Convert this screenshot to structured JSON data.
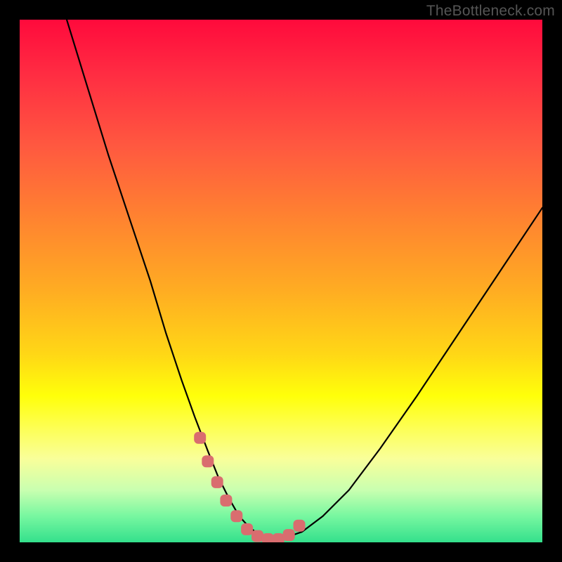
{
  "watermark": "TheBottleneck.com",
  "colors": {
    "page_bg": "#000000",
    "gradient_top": "#ff0a3c",
    "gradient_bottom": "#34e08c",
    "curve": "#000000",
    "marker": "#d96d6f"
  },
  "chart_data": {
    "type": "line",
    "title": "",
    "xlabel": "",
    "ylabel": "",
    "xlim": [
      0,
      100
    ],
    "ylim": [
      0,
      100
    ],
    "grid": false,
    "note": "No axis ticks or numeric labels are rendered; values are estimated from pixel positions (x is horizontal 0-100 left→right, y is vertical 0-100 bottom→top).",
    "series": [
      {
        "name": "curve",
        "x": [
          9,
          13,
          17,
          21,
          25,
          28,
          31,
          33.5,
          36,
          38,
          40,
          42,
          44,
          46,
          48,
          50,
          54,
          58,
          63,
          69,
          76,
          84,
          92,
          100
        ],
        "y": [
          100,
          87,
          74,
          62,
          50,
          40,
          31,
          24,
          17.5,
          12.5,
          8.5,
          5,
          2.8,
          1.4,
          0.6,
          0.6,
          2,
          5,
          10,
          18,
          28,
          40,
          52,
          64
        ]
      },
      {
        "name": "bottleneck-markers",
        "x": [
          34.5,
          36,
          37.8,
          39.5,
          41.5,
          43.5,
          45.5,
          47.5,
          49.5,
          51.5,
          53.5
        ],
        "y": [
          20,
          15.5,
          11.5,
          8,
          5,
          2.5,
          1.2,
          0.6,
          0.6,
          1.4,
          3.2
        ]
      }
    ]
  }
}
